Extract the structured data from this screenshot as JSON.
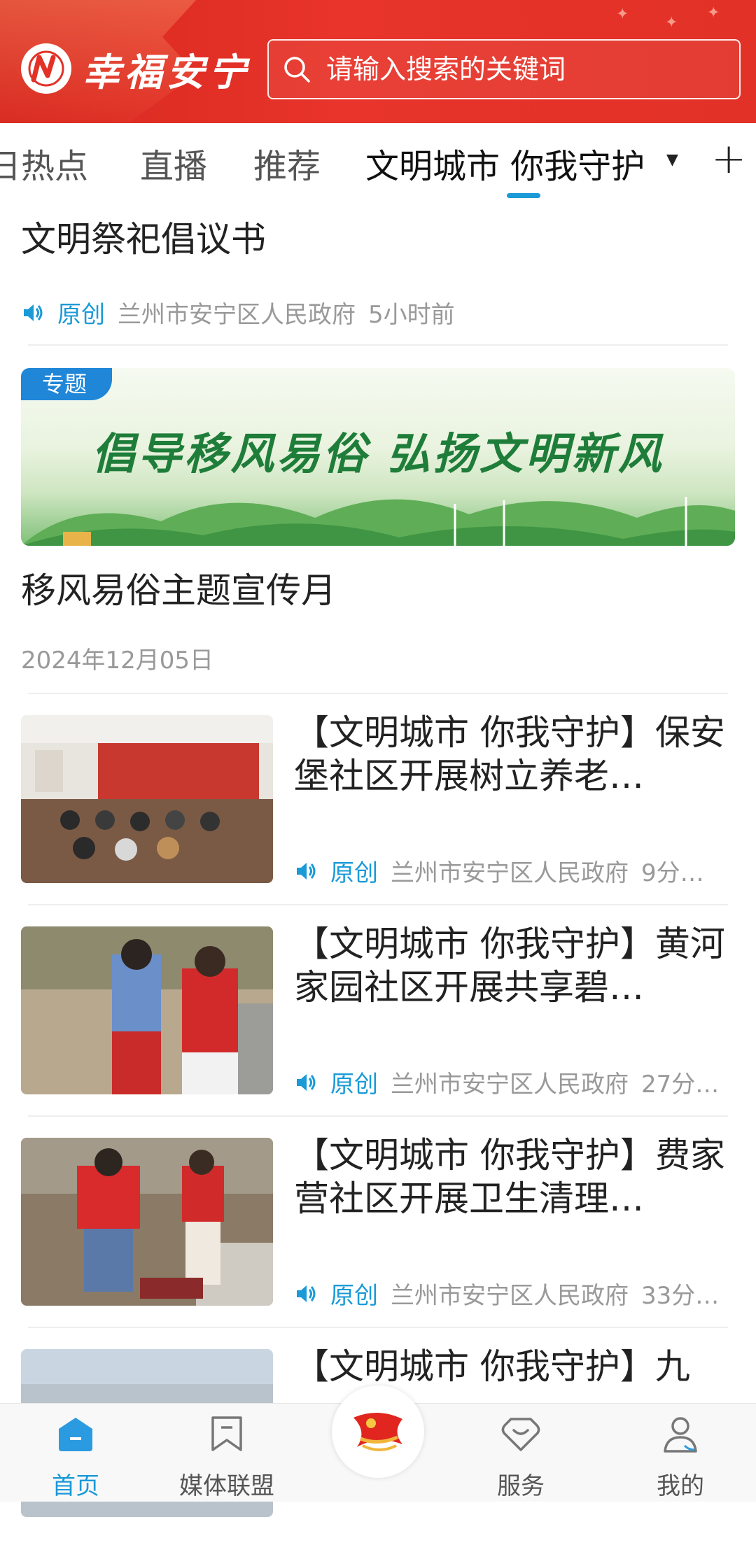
{
  "header": {
    "app_name": "幸福安宁",
    "search_placeholder": "请输入搜索的关键词"
  },
  "tabs": [
    {
      "label": "日热点",
      "active": false
    },
    {
      "label": "直播",
      "active": false
    },
    {
      "label": "推荐",
      "active": false
    },
    {
      "label": "文明城市 你我守护",
      "active": true
    }
  ],
  "headline": {
    "title": "文明祭祀倡议书",
    "original_label": "原创",
    "source": "兰州市安宁区人民政府",
    "time": "5小时前"
  },
  "topic": {
    "badge": "专题",
    "banner_slogan": "倡导移风易俗  弘扬文明新风",
    "title": "移风易俗主题宣传月",
    "date": "2024年12月05日"
  },
  "news": [
    {
      "title": "【文明城市 你我守护】保安堡社区开展树立养老…",
      "original_label": "原创",
      "source": "兰州市安宁区人民政府",
      "time": "9分…"
    },
    {
      "title": "【文明城市 你我守护】黄河家园社区开展共享碧…",
      "original_label": "原创",
      "source": "兰州市安宁区人民政府",
      "time": "27分…"
    },
    {
      "title": "【文明城市 你我守护】费家营社区开展卫生清理…",
      "original_label": "原创",
      "source": "兰州市安宁区人民政府",
      "time": "33分…"
    },
    {
      "title": "【文明城市 你我守护】九"
    }
  ],
  "bottom_nav": [
    {
      "label": "首页",
      "icon": "home-icon",
      "active": true
    },
    {
      "label": "媒体联盟",
      "icon": "bookmark-icon",
      "active": false
    },
    {
      "label": "服务",
      "icon": "service-icon",
      "active": false
    },
    {
      "label": "我的",
      "icon": "user-icon",
      "active": false
    }
  ],
  "colors": {
    "brand_red": "#e23127",
    "accent_blue": "#1a9ad7",
    "meta_gray": "#999999"
  }
}
